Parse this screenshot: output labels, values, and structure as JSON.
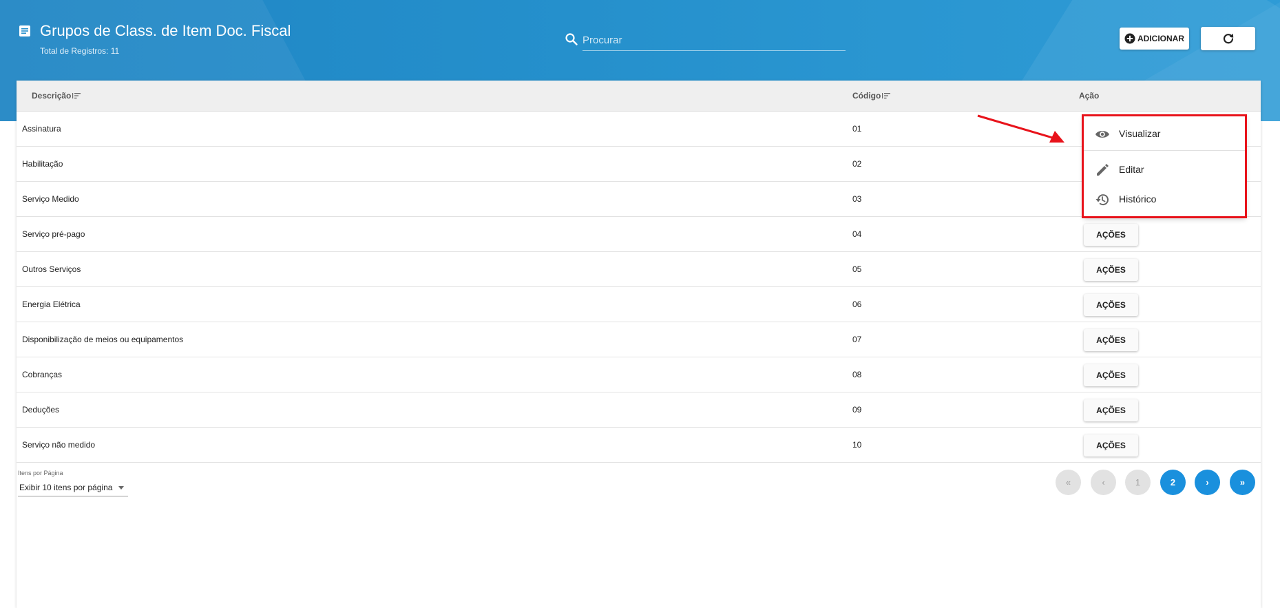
{
  "header": {
    "title": "Grupos de Class. de Item Doc. Fiscal",
    "subtitle": "Total de Registros: 11",
    "search_placeholder": "Procurar",
    "add_label": "ADICIONAR"
  },
  "table": {
    "columns": [
      "Descrição",
      "Código",
      "Ação"
    ],
    "action_label": "AÇÕES",
    "rows": [
      {
        "descricao": "Assinatura",
        "codigo": "01"
      },
      {
        "descricao": "Habilitação",
        "codigo": "02"
      },
      {
        "descricao": "Serviço Medido",
        "codigo": "03"
      },
      {
        "descricao": "Serviço pré-pago",
        "codigo": "04"
      },
      {
        "descricao": "Outros Serviços",
        "codigo": "05"
      },
      {
        "descricao": "Energia Elétrica",
        "codigo": "06"
      },
      {
        "descricao": "Disponibilização de meios ou equipamentos",
        "codigo": "07"
      },
      {
        "descricao": "Cobranças",
        "codigo": "08"
      },
      {
        "descricao": "Deduções",
        "codigo": "09"
      },
      {
        "descricao": "Serviço não medido",
        "codigo": "10"
      }
    ]
  },
  "pagination": {
    "items_label": "Itens por Página",
    "items_value": "Exibir 10 itens por página",
    "first": "«",
    "prev": "‹",
    "pages": [
      "1",
      "2"
    ],
    "current_page": "2",
    "next": "›",
    "last": "»"
  },
  "menu": {
    "items": [
      {
        "label": "Visualizar",
        "icon": "eye-icon"
      },
      {
        "label": "Editar",
        "icon": "pencil-icon"
      },
      {
        "label": "Histórico",
        "icon": "history-icon"
      }
    ]
  },
  "colors": {
    "header": "#2590cc",
    "accent": "#1a90dd",
    "highlight": "#e8131b"
  }
}
